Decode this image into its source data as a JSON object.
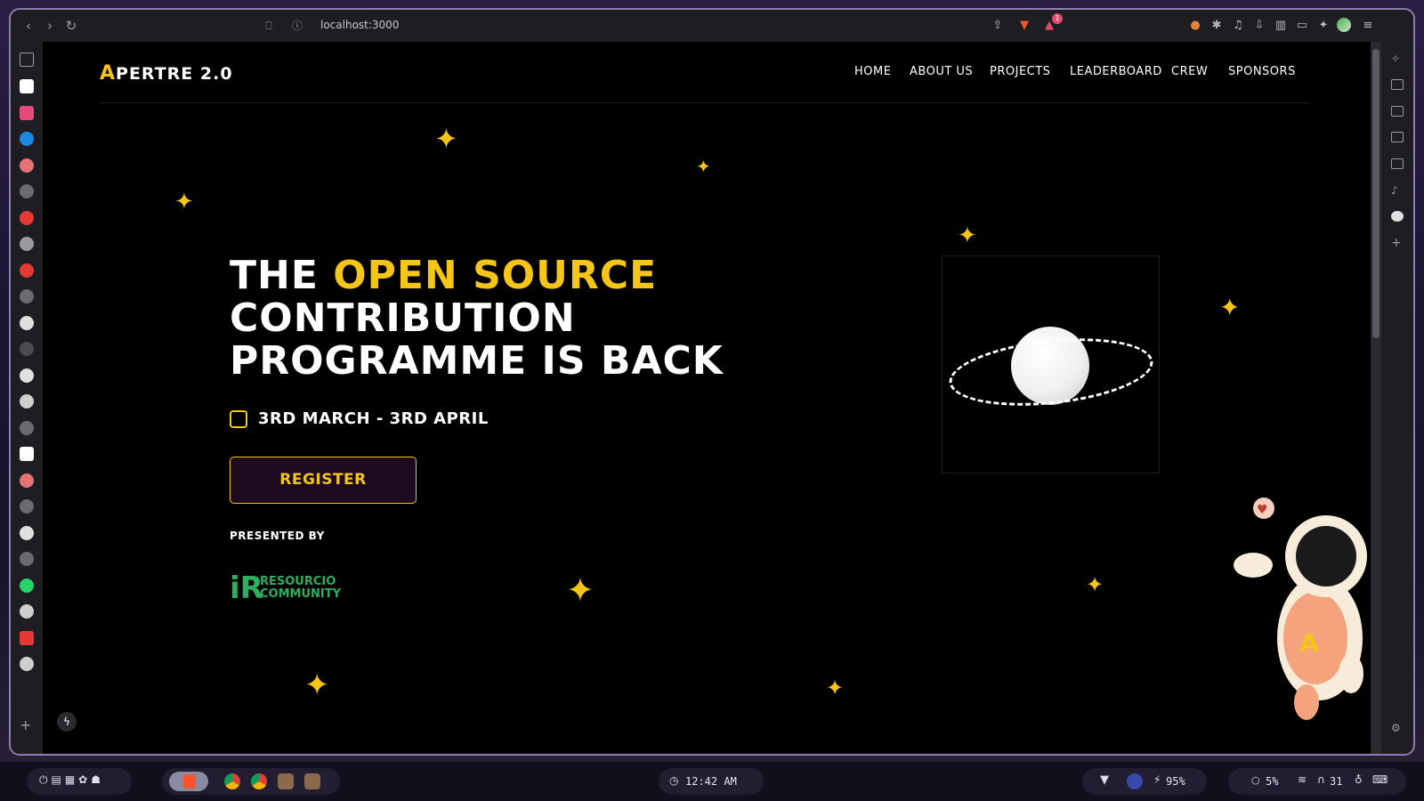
{
  "browser": {
    "url": "localhost:3000",
    "nav_back": "‹",
    "nav_forward": "›",
    "reload": "↻",
    "bookmark": "⎕",
    "info": "ⓘ",
    "share": "⇪",
    "notification_badge": "1"
  },
  "site": {
    "logo_letter": "A",
    "logo_rest": "PERTRE 2.0",
    "nav": [
      "HOME",
      "ABOUT US",
      "PROJECTS",
      "LEADERBOARD",
      "CREW",
      "SPONSORS"
    ],
    "headline_line1_white": "THE ",
    "headline_line1_yellow": "OPEN SOURCE",
    "headline_line2": "CONTRIBUTION",
    "headline_line3": "PROGRAMME IS BACK",
    "date_range": "3RD MARCH - 3RD APRIL",
    "register_label": "REGISTER",
    "presented_by": "PRESENTED BY",
    "presenter_logo": "iR",
    "presenter_line1": "RESOURCIO",
    "presenter_line2": "COMMUNITY"
  },
  "taskbar": {
    "clock": "12:42 AM",
    "battery": "95%",
    "cpu": "5%",
    "volume": "31"
  },
  "icons": {
    "bolt": "ϟ",
    "heart": "♥"
  },
  "colors": {
    "accent": "#f5c518",
    "background": "#000000",
    "presenter_green": "#2fae5f"
  }
}
